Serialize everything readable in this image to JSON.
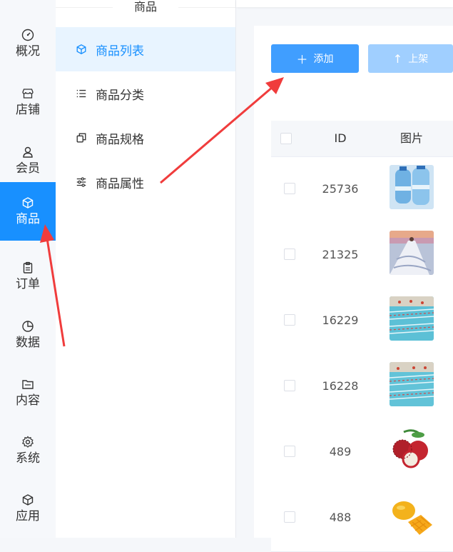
{
  "rail": {
    "items": [
      {
        "label": "概况",
        "icon": "dashboard-icon"
      },
      {
        "label": "店铺",
        "icon": "store-icon"
      },
      {
        "label": "会员",
        "icon": "user-icon"
      },
      {
        "label": "商品",
        "icon": "box-icon",
        "active": true
      },
      {
        "label": "订单",
        "icon": "clipboard-icon"
      },
      {
        "label": "数据",
        "icon": "pie-chart-icon"
      },
      {
        "label": "内容",
        "icon": "folder-icon"
      },
      {
        "label": "系统",
        "icon": "gear-icon"
      },
      {
        "label": "应用",
        "icon": "cube-icon"
      }
    ]
  },
  "submenu": {
    "title": "商品",
    "items": [
      {
        "label": "商品列表",
        "icon": "box-icon",
        "active": true
      },
      {
        "label": "商品分类",
        "icon": "list-icon"
      },
      {
        "label": "商品规格",
        "icon": "copy-icon"
      },
      {
        "label": "商品属性",
        "icon": "sliders-icon"
      }
    ]
  },
  "toolbar": {
    "add_label": "添加",
    "shelve_label": "上架"
  },
  "table": {
    "columns": [
      "ID",
      "图片"
    ],
    "rows": [
      {
        "id": "25736",
        "image": "water-bottles"
      },
      {
        "id": "21325",
        "image": "dress-photo"
      },
      {
        "id": "16229",
        "image": "swimming-pool"
      },
      {
        "id": "16228",
        "image": "swimming-pool"
      },
      {
        "id": "489",
        "image": "lychee"
      },
      {
        "id": "488",
        "image": "mango"
      }
    ]
  },
  "colors": {
    "accent": "#1890ff",
    "button_primary": "#409eff",
    "button_disabled": "#a0cfff",
    "annotation_arrow": "#f03c3c"
  }
}
